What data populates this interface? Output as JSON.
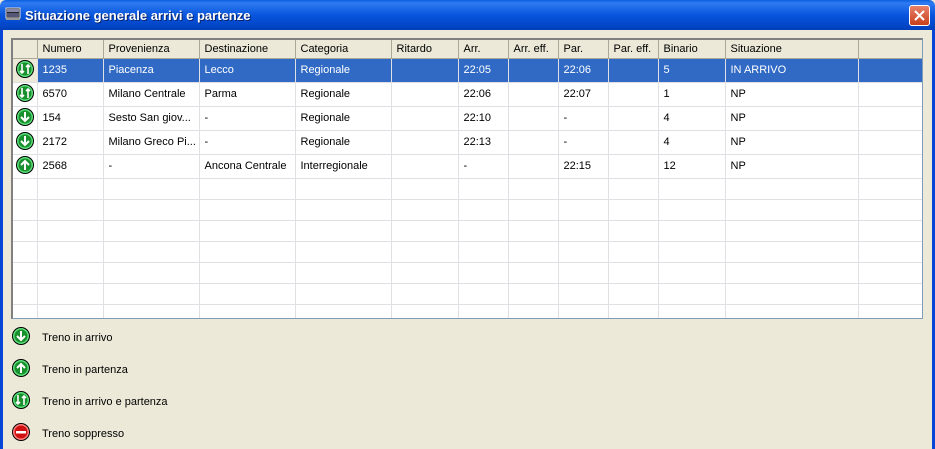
{
  "window": {
    "title": "Situazione generale arrivi e partenze"
  },
  "grid": {
    "columns": [
      "",
      "Numero",
      "Provenienza",
      "Destinazione",
      "Categoria",
      "Ritardo",
      "Arr.",
      "Arr. eff.",
      "Par.",
      "Par. eff.",
      "Binario",
      "Situazione",
      ""
    ],
    "rows": [
      {
        "icon": "arrival-departure",
        "numero": "1235",
        "provenienza": "Piacenza",
        "destinazione": "Lecco",
        "categoria": "Regionale",
        "ritardo": "",
        "arr": "22:05",
        "arr_eff": "",
        "par": "22:06",
        "par_eff": "",
        "binario": "5",
        "situazione": "IN ARRIVO"
      },
      {
        "icon": "arrival-departure",
        "numero": "6570",
        "provenienza": "Milano Centrale",
        "destinazione": "Parma",
        "categoria": "Regionale",
        "ritardo": "",
        "arr": "22:06",
        "arr_eff": "",
        "par": "22:07",
        "par_eff": "",
        "binario": "1",
        "situazione": "NP"
      },
      {
        "icon": "arrival",
        "numero": "154",
        "provenienza": "Sesto San giov...",
        "destinazione": "-",
        "categoria": "Regionale",
        "ritardo": "",
        "arr": "22:10",
        "arr_eff": "",
        "par": "-",
        "par_eff": "",
        "binario": "4",
        "situazione": "NP"
      },
      {
        "icon": "arrival",
        "numero": "2172",
        "provenienza": "Milano Greco Pi...",
        "destinazione": "-",
        "categoria": "Regionale",
        "ritardo": "",
        "arr": "22:13",
        "arr_eff": "",
        "par": "-",
        "par_eff": "",
        "binario": "4",
        "situazione": "NP"
      },
      {
        "icon": "departure",
        "numero": "2568",
        "provenienza": "-",
        "destinazione": "Ancona Centrale",
        "categoria": "Interregionale",
        "ritardo": "",
        "arr": "-",
        "arr_eff": "",
        "par": "22:15",
        "par_eff": "",
        "binario": "12",
        "situazione": "NP"
      }
    ],
    "selected_row": 0
  },
  "legend": [
    {
      "icon": "arrival",
      "label": "Treno in arrivo"
    },
    {
      "icon": "departure",
      "label": "Treno in partenza"
    },
    {
      "icon": "arrival-departure",
      "label": "Treno in arrivo e partenza"
    },
    {
      "icon": "cancelled",
      "label": "Treno soppresso"
    }
  ],
  "colors": {
    "titlebar": "#0855dd",
    "selection": "#316ac5",
    "train_icon_fill": "#1a8f2e",
    "train_icon_ring": "#5be07a",
    "cancelled_fill": "#d01010"
  }
}
